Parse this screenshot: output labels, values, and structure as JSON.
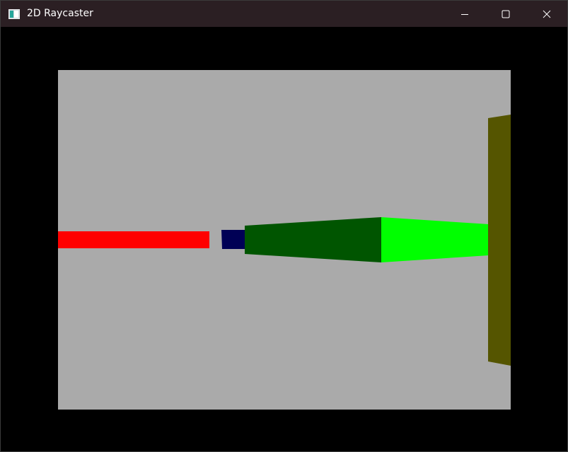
{
  "window": {
    "title": "2D Raycaster",
    "app_icon": "window-app-icon",
    "controls": {
      "minimize_icon": "minimize-icon",
      "maximize_icon": "maximize-icon",
      "close_icon": "close-icon"
    }
  },
  "colors": {
    "titlebar": "#2b1f23",
    "client_background": "#000000",
    "floor_ceiling": "#aaaaaa",
    "wall_red": "#ff0000",
    "wall_navy": "#000055",
    "wall_dark_green": "#005500",
    "wall_bright_green": "#00ff00",
    "wall_olive": "#555500"
  }
}
